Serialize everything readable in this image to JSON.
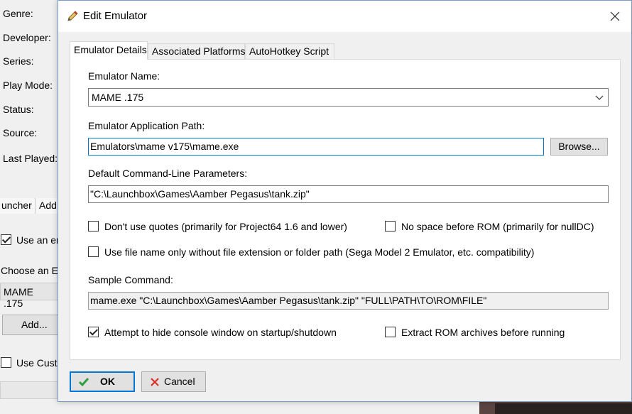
{
  "background": {
    "labels": [
      "Genre:",
      "Developer:",
      "Series:",
      "Play Mode:",
      "Status:",
      "Source:",
      "Last Played:"
    ],
    "tabs": [
      "uncher",
      "Add"
    ],
    "use_emulator_label": "Use an em",
    "choose_label": "Choose an Em",
    "emulator_value": "MAME .175",
    "add_button": "Add...",
    "use_custom_label": "Use Custo"
  },
  "dialog": {
    "title": "Edit Emulator",
    "tabs": [
      "Emulator Details",
      "Associated Platforms",
      "AutoHotkey Script"
    ],
    "emulator_name_label": "Emulator Name:",
    "emulator_name_value": "MAME .175",
    "app_path_label": "Emulator Application Path:",
    "app_path_value": "Emulators\\mame v175\\mame.exe",
    "browse_button": "Browse...",
    "cmd_params_label": "Default Command-Line Parameters:",
    "cmd_params_value": "\"C:\\Launchbox\\Games\\Aamber Pegasus\\tank.zip\"",
    "checkboxes": {
      "no_quotes": "Don't use quotes (primarily for Project64 1.6 and lower)",
      "no_space": "No space before ROM (primarily for nullDC)",
      "file_name_only": "Use file name only without file extension or folder path (Sega Model 2 Emulator, etc. compatibility)",
      "hide_console": "Attempt to hide console window on startup/shutdown",
      "extract_rom": "Extract ROM archives before running"
    },
    "sample_command_label": "Sample Command:",
    "sample_command_value": "mame.exe \"C:\\Launchbox\\Games\\Aamber Pegasus\\tank.zip\" \"FULL\\PATH\\TO\\ROM\\FILE\"",
    "ok_button": "OK",
    "cancel_button": "Cancel"
  },
  "colors": {
    "accent": "#0078d7",
    "ok_check": "#2ea043",
    "cancel_x": "#d93025"
  },
  "icons": {
    "title": "pencil-icon",
    "close": "close-icon",
    "ok": "checkmark-icon",
    "cancel": "x-icon"
  }
}
